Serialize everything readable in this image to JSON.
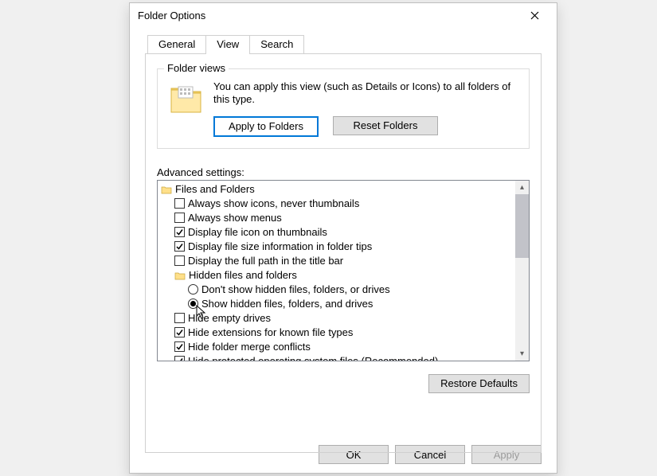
{
  "window": {
    "title": "Folder Options"
  },
  "tabs": {
    "general": "General",
    "view": "View",
    "search": "Search",
    "active": "view"
  },
  "folder_views": {
    "legend": "Folder views",
    "description": "You can apply this view (such as Details or Icons) to all folders of this type.",
    "apply_btn": "Apply to Folders",
    "reset_btn": "Reset Folders"
  },
  "advanced": {
    "label": "Advanced settings:",
    "root": "Files and Folders",
    "items": [
      {
        "type": "check",
        "checked": false,
        "label": "Always show icons, never thumbnails"
      },
      {
        "type": "check",
        "checked": false,
        "label": "Always show menus"
      },
      {
        "type": "check",
        "checked": true,
        "label": "Display file icon on thumbnails"
      },
      {
        "type": "check",
        "checked": true,
        "label": "Display file size information in folder tips"
      },
      {
        "type": "check",
        "checked": false,
        "label": "Display the full path in the title bar"
      },
      {
        "type": "group",
        "label": "Hidden files and folders"
      },
      {
        "type": "radio",
        "checked": false,
        "label": "Don't show hidden files, folders, or drives"
      },
      {
        "type": "radio",
        "checked": true,
        "label": "Show hidden files, folders, and drives"
      },
      {
        "type": "check",
        "checked": false,
        "label": "Hide empty drives"
      },
      {
        "type": "check",
        "checked": true,
        "label": "Hide extensions for known file types"
      },
      {
        "type": "check",
        "checked": true,
        "label": "Hide folder merge conflicts"
      },
      {
        "type": "check",
        "checked": true,
        "label": "Hide protected operating system files (Recommended)"
      }
    ]
  },
  "restore_btn": "Restore Defaults",
  "footer": {
    "ok": "OK",
    "cancel": "Cancel",
    "apply": "Apply"
  }
}
